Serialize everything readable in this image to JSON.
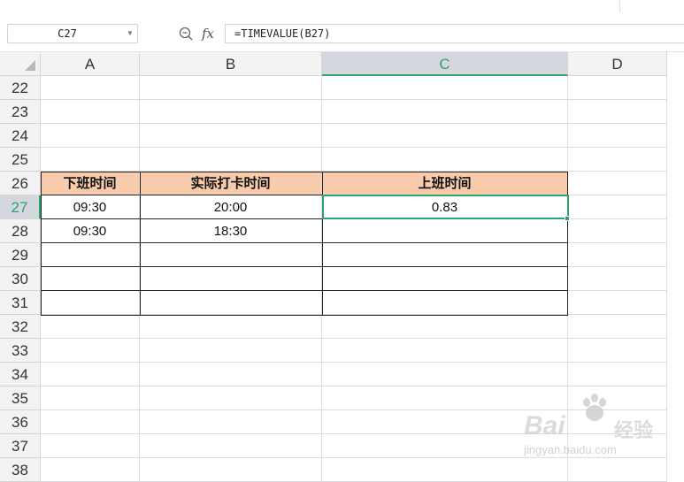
{
  "name_box": {
    "value": "C27"
  },
  "formula_bar": {
    "fx_label": "fx",
    "formula": "=TIMEVALUE(B27)"
  },
  "columns": [
    {
      "letter": "A"
    },
    {
      "letter": "B"
    },
    {
      "letter": "C",
      "active": true
    },
    {
      "letter": "D"
    }
  ],
  "rows": [
    22,
    23,
    24,
    25,
    26,
    27,
    28,
    29,
    30,
    31,
    32,
    33,
    34,
    35,
    36,
    37,
    38
  ],
  "active_cell": "C27",
  "table": {
    "headers": [
      "下班时间",
      "实际打卡时间",
      "上班时间"
    ],
    "rows": [
      [
        "09:30",
        "20:00",
        "0.83"
      ],
      [
        "09:30",
        "18:30",
        ""
      ],
      [
        "",
        "",
        ""
      ],
      [
        "",
        "",
        ""
      ],
      [
        "",
        "",
        ""
      ]
    ]
  },
  "colors": {
    "header_fill": "#f8cbad",
    "selection": "#2fa36b",
    "active_header": "#d4d7de"
  },
  "icons": {
    "zoom": "zoom-formula-icon",
    "dropdown": "chevron-down-icon",
    "select_all": "select-all-triangle-icon"
  },
  "watermark": {
    "brand_left": "Bai",
    "brand_right": "经验",
    "url": "jingyan.baidu.com"
  }
}
